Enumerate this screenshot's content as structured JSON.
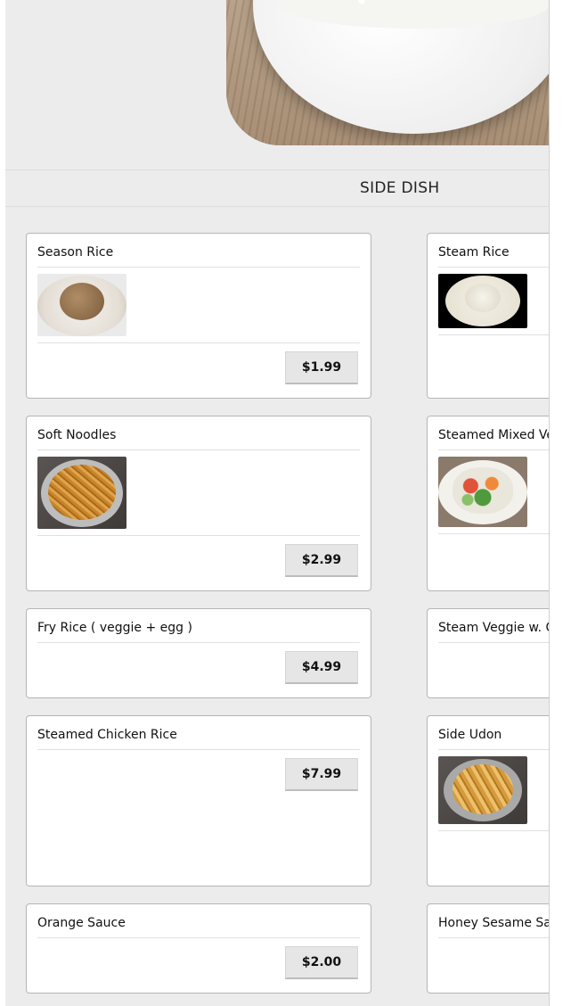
{
  "section": {
    "title": "SIDE DISH"
  },
  "hero": {
    "icon": "rice-bowl-photo"
  },
  "left_column": [
    {
      "name": "Season Rice",
      "price": "$1.99",
      "thumb": "season-rice-photo"
    },
    {
      "name": "Soft Noodles",
      "price": "$2.99",
      "thumb": "soft-noodles-photo"
    },
    {
      "name": "Fry Rice ( veggie + egg )",
      "price": "$4.99"
    },
    {
      "name": "Steamed Chicken Rice",
      "price": "$7.99"
    },
    {
      "name": "Orange Sauce",
      "price": "$2.00"
    }
  ],
  "right_column": [
    {
      "name": "Steam Rice",
      "thumb": "steam-rice-photo"
    },
    {
      "name": "Steamed Mixed Veg",
      "thumb": "mixed-veg-photo"
    },
    {
      "name": "Steam Veggie w. Cl"
    },
    {
      "name": "Side Udon",
      "thumb": "side-udon-photo"
    },
    {
      "name": "Honey Sesame Sau"
    }
  ]
}
